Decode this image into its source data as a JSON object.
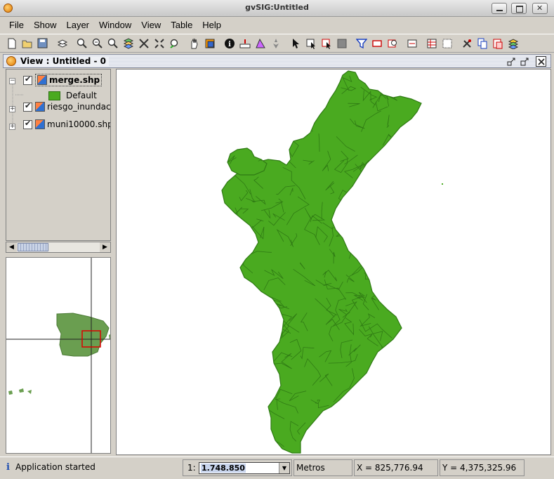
{
  "window": {
    "title": "gvSIG:Untitled"
  },
  "menu": [
    "File",
    "Show",
    "Layer",
    "Window",
    "View",
    "Table",
    "Help"
  ],
  "toolbar_icons": [
    "new-icon",
    "open-icon",
    "save-icon",
    "add-layer-icon",
    "zoom-in-icon",
    "zoom-out-icon",
    "zoom-select-icon",
    "zoom-full-icon",
    "zoom-extent-icon",
    "zoom-plus-icon",
    "zoom-back-icon",
    "pan-icon",
    "overview-icon",
    "info-icon",
    "measure-icon",
    "area-icon",
    "locate-icon",
    "select-icon",
    "select-rect-icon",
    "select-poly-icon",
    "select-all-icon",
    "filter-icon",
    "rectangle-icon",
    "zoom-layer-icon",
    "show-table-icon",
    "properties-icon",
    "grid-icon",
    "tools-icon",
    "copy-icon",
    "paste-icon",
    "layers-icon"
  ],
  "view": {
    "title": "View : Untitled  - 0"
  },
  "toc": {
    "layers": [
      {
        "name": "merge.shp",
        "checked": true,
        "selected": true,
        "legend": "Default"
      },
      {
        "name": "riesgo_inundaci",
        "checked": true
      },
      {
        "name": "muni10000.shp",
        "checked": true
      }
    ]
  },
  "map": {
    "fill_color": "#4aaa20",
    "stroke_color": "#2f7a14"
  },
  "status": {
    "message": "Application started",
    "scale_prefix": "1:",
    "scale_value": "1.748.850",
    "units": "Metros",
    "x": "X = 825,776.94",
    "y": "Y = 4,375,325.96"
  }
}
